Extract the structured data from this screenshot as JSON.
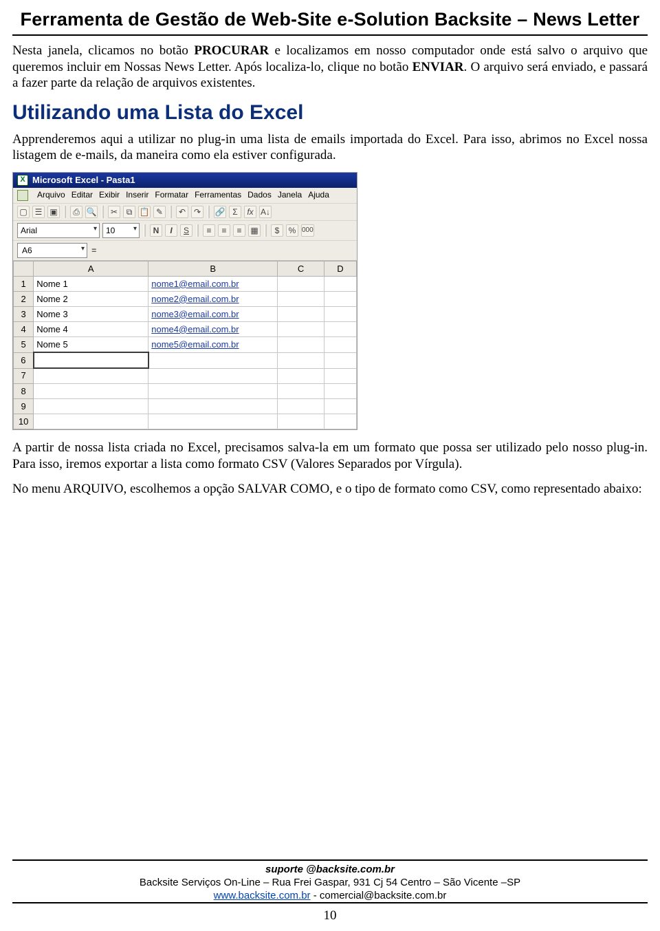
{
  "header": {
    "title": "Ferramenta de Gestão de Web-Site e-Solution Backsite – News Letter"
  },
  "paragraphs": {
    "p1_a": "Nesta janela, clicamos no botão ",
    "p1_bold1": "PROCURAR",
    "p1_b": " e localizamos em nosso computador onde está salvo o arquivo que queremos incluir em Nossas News Letter. Após localiza-lo, clique no botão ",
    "p1_bold2": "ENVIAR",
    "p1_c": ". O arquivo será enviado, e passará a fazer parte da relação de arquivos existentes.",
    "h1": "Utilizando uma Lista do Excel",
    "p2": "Apprenderemos aqui a utilizar no plug-in uma lista de emails importada do Excel. Para isso, abrimos no Excel nossa listagem de e-mails, da maneira como ela estiver configurada.",
    "p3": "A partir de nossa lista criada no Excel, precisamos salva-la em um formato que possa ser utilizado pelo nosso plug-in. Para isso, iremos exportar a lista como formato CSV (Valores Separados por Vírgula).",
    "p4": "No menu ARQUIVO, escolhemos a opção SALVAR COMO, e o tipo de formato como CSV, como representado abaixo:"
  },
  "excel": {
    "title": "Microsoft Excel - Pasta1",
    "menus": [
      "Arquivo",
      "Editar",
      "Exibir",
      "Inserir",
      "Formatar",
      "Ferramentas",
      "Dados",
      "Janela",
      "Ajuda"
    ],
    "font_name": "Arial",
    "font_size": "10",
    "name_box": "A6",
    "columns": [
      "A",
      "B",
      "C",
      "D"
    ],
    "row_numbers": [
      "1",
      "2",
      "3",
      "4",
      "5",
      "6",
      "7",
      "8",
      "9",
      "10"
    ],
    "cells": {
      "A": [
        "Nome 1",
        "Nome 2",
        "Nome 3",
        "Nome 4",
        "Nome 5",
        "",
        "",
        "",
        "",
        ""
      ],
      "B": [
        "nome1@email.com.br",
        "nome2@email.com.br",
        "nome3@email.com.br",
        "nome4@email.com.br",
        "nome5@email.com.br",
        "",
        "",
        "",
        "",
        ""
      ]
    },
    "toolbar_icons": {
      "new": "new-icon",
      "open": "open-icon",
      "save": "save-icon",
      "print": "print-icon",
      "preview": "preview-icon",
      "cut": "cut-icon",
      "copy": "copy-icon",
      "paste": "paste-icon",
      "format_painter": "format-painter-icon",
      "undo": "undo-icon",
      "redo": "redo-icon",
      "hyperlink": "hyperlink-icon",
      "autosum": "autosum-icon",
      "function": "function-icon",
      "sort": "sort-icon",
      "bold": "B",
      "italic": "I",
      "underline": "S",
      "align_left": "align-left-icon",
      "align_center": "align-center-icon",
      "align_right": "align-right-icon",
      "merge": "merge-icon",
      "currency": "currency-icon",
      "percent": "%",
      "comma": "000"
    }
  },
  "footer": {
    "email": "suporte @backsite.com.br",
    "addr": "Backsite Serviços On-Line – Rua Frei Gaspar, 931 Cj 54  Centro – São Vicente –SP",
    "site": "www.backsite.com.br",
    "sep": " - ",
    "commercial": "comercial@backsite.com.br",
    "page": "10"
  }
}
